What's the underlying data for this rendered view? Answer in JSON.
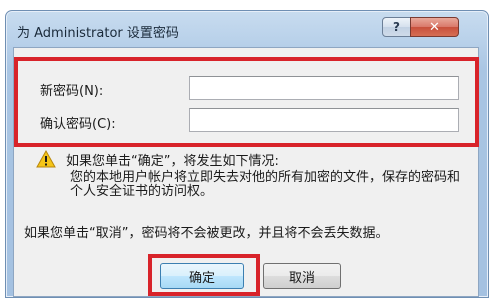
{
  "window": {
    "title": "为 Administrator 设置密码",
    "help_glyph": "?",
    "close_glyph": "✕"
  },
  "fields": {
    "new_password": {
      "label": "新密码(N):",
      "value": ""
    },
    "confirm_password": {
      "label": "确认密码(C):",
      "value": ""
    }
  },
  "warning": {
    "icon": "warning-icon",
    "heading": "如果您单击“确定”，将发生如下情况:",
    "body": "您的本地用户帐户将立即失去对他的所有加密的文件，保存的密码和个人安全证书的访问权。"
  },
  "note": "如果您单击“取消”，密码将不会被更改，并且将不会丢失数据。",
  "buttons": {
    "ok": "确定",
    "cancel": "取消"
  },
  "colors": {
    "highlight": "#d8232a",
    "warning_yellow": "#f5c518"
  }
}
